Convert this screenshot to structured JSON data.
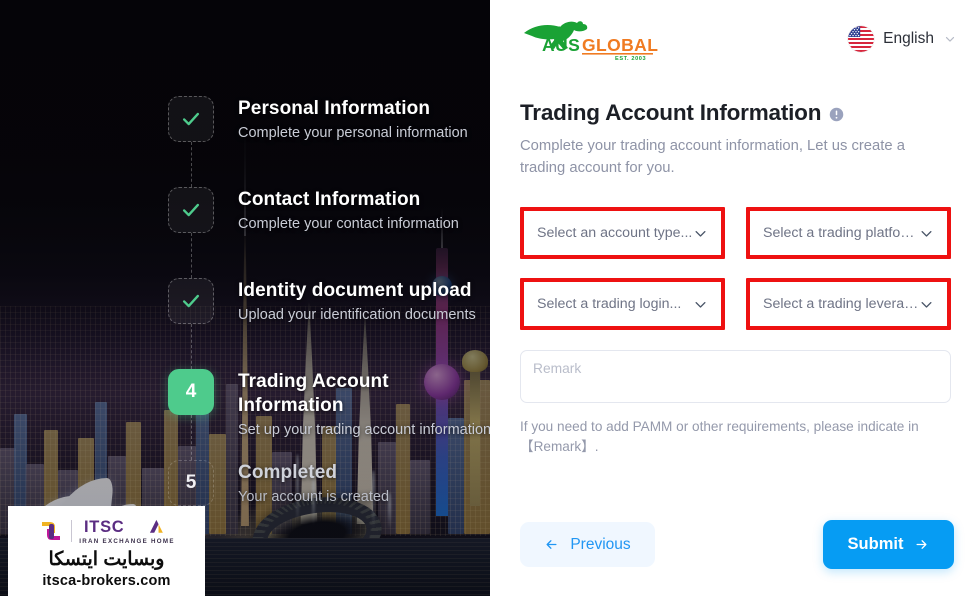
{
  "brand": {
    "name_primary": "AUS",
    "name_secondary": "GLOBAL",
    "established": "EST. 2003",
    "logo_icon": "kangaroo-icon",
    "color_primary": "#1aa235",
    "color_secondary": "#f07b22"
  },
  "topbar": {
    "language": {
      "label": "English",
      "flag_icon": "us-flag-icon",
      "chevron_icon": "chevron-down-icon"
    }
  },
  "left_panel": {
    "steps": [
      {
        "index": "1",
        "title": "Personal Information",
        "subtitle": "Complete your personal information",
        "state": "done",
        "marker_icon": "check-icon"
      },
      {
        "index": "2",
        "title": "Contact Information",
        "subtitle": "Complete your contact information",
        "state": "done",
        "marker_icon": "check-icon"
      },
      {
        "index": "3",
        "title": "Identity document upload",
        "subtitle": "Upload your identification documents",
        "state": "done",
        "marker_icon": "check-icon"
      },
      {
        "index": "4",
        "title": "Trading Account Information",
        "subtitle": "Set up your trading account information",
        "state": "active",
        "marker_icon": "step-number"
      },
      {
        "index": "5",
        "title": "Completed",
        "subtitle": "Your account is created",
        "state": "pending",
        "marker_icon": "step-number"
      }
    ],
    "accent_done": "#4ecb8c",
    "accent_active": "#4ecb8c"
  },
  "watermark": {
    "logo_text": "ITSCA",
    "tagline": "IRAN EXCHANGE HOME",
    "persian_text": "وبسایت ایتسکا",
    "url": "itsca-brokers.com",
    "mark_icon": "itsca-logo-icon"
  },
  "main": {
    "title": "Trading Account Information",
    "title_info_icon": "info-circle-icon",
    "subtitle": "Complete your trading account information, Let us create a trading account for you.",
    "fields": [
      {
        "name": "account-type",
        "placeholder": "Select an account type...",
        "value": "",
        "chevron_icon": "chevron-down-icon",
        "highlight_color": "#ee1111"
      },
      {
        "name": "trading-platform",
        "placeholder": "Select a trading platform...",
        "value": "",
        "chevron_icon": "chevron-down-icon",
        "highlight_color": "#ee1111"
      },
      {
        "name": "trading-login",
        "placeholder": "Select a trading login...",
        "value": "",
        "chevron_icon": "chevron-down-icon",
        "highlight_color": "#ee1111"
      },
      {
        "name": "trading-leverage",
        "placeholder": "Select a trading leverage...",
        "value": "",
        "chevron_icon": "chevron-down-icon",
        "highlight_color": "#ee1111"
      }
    ],
    "remark": {
      "placeholder": "Remark",
      "value": ""
    },
    "hint": "If you need to add PAMM or other requirements, please indicate in 【Remark】.",
    "buttons": {
      "previous": {
        "label": "Previous",
        "icon": "arrow-left-icon",
        "color": "#2196f3"
      },
      "submit": {
        "label": "Submit",
        "icon": "arrow-right-icon",
        "color": "#069cf3"
      }
    }
  }
}
